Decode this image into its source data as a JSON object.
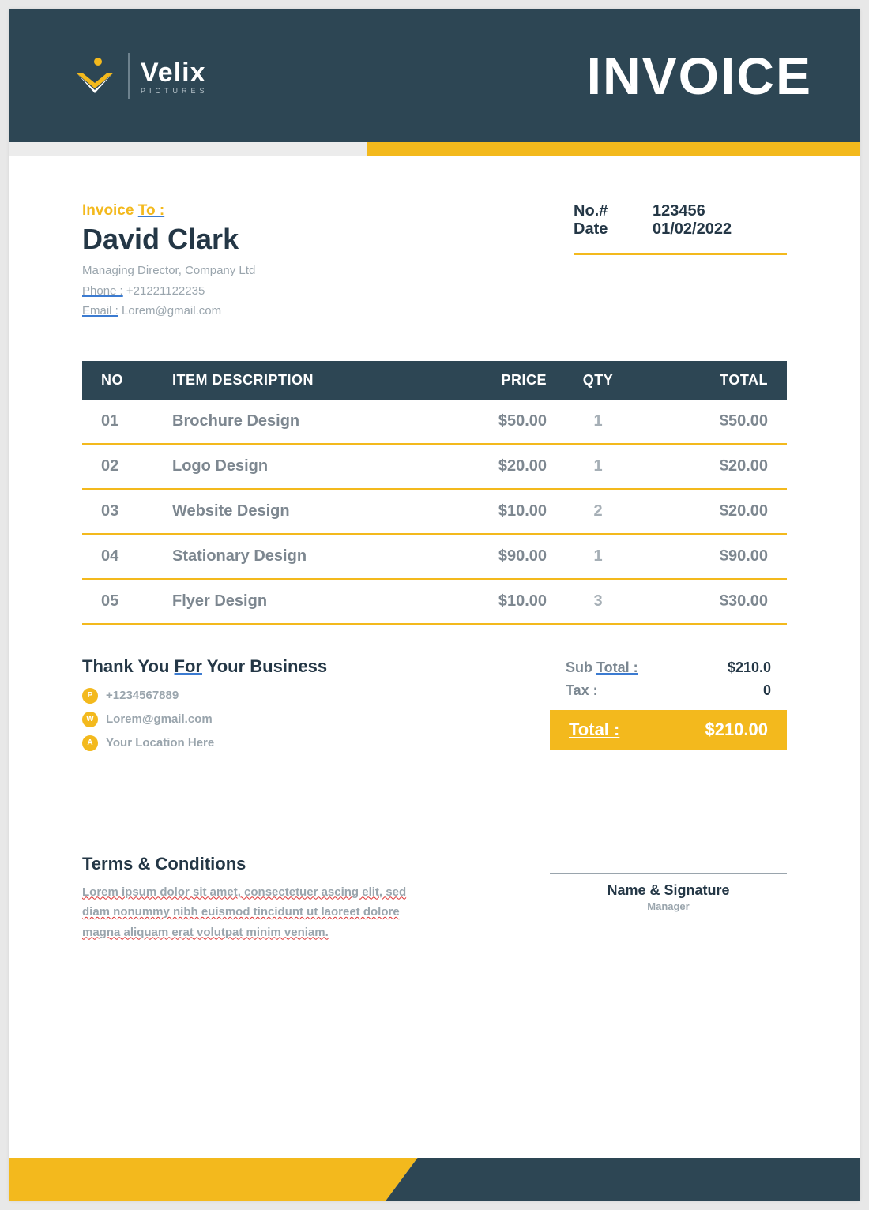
{
  "colors": {
    "dark": "#2d4654",
    "accent": "#f3b91d",
    "muted": "#9aa5ad"
  },
  "brand": {
    "name": "Velix",
    "sub": "PICTURES"
  },
  "title": "INVOICE",
  "invoice_to": {
    "label_a": "Invoice ",
    "label_b": "To :",
    "name": "David Clark",
    "role": "Managing Director, Company Ltd",
    "phone_label": "Phone :",
    "phone": " +21221122235",
    "email_label": "Email :",
    "email": " Lorem@gmail.com"
  },
  "meta": {
    "number_label": "No.#",
    "number": "123456",
    "date_label": "Date",
    "date": "01/02/2022"
  },
  "table": {
    "headers": {
      "no": "NO",
      "desc": "ITEM DESCRIPTION",
      "price": "PRICE",
      "qty": "QTY",
      "total": "TOTAL"
    },
    "rows": [
      {
        "no": "01",
        "desc": "Brochure Design",
        "price": "$50.00",
        "qty": "1",
        "total": "$50.00"
      },
      {
        "no": "02",
        "desc": "Logo Design",
        "price": "$20.00",
        "qty": "1",
        "total": "$20.00"
      },
      {
        "no": "03",
        "desc": "Website Design",
        "price": "$10.00",
        "qty": "2",
        "total": "$20.00"
      },
      {
        "no": "04",
        "desc": "Stationary Design",
        "price": "$90.00",
        "qty": "1",
        "total": "$90.00"
      },
      {
        "no": "05",
        "desc": "Flyer Design",
        "price": "$10.00",
        "qty": "3",
        "total": "$30.00"
      }
    ]
  },
  "thank_you": {
    "pre": "Thank You ",
    "mid": "For",
    "post": " Your Business"
  },
  "contacts": [
    {
      "icon": "P",
      "text": "+1234567889"
    },
    {
      "icon": "W",
      "text": "Lorem@gmail.com"
    },
    {
      "icon": "A",
      "text": "Your Location Here"
    }
  ],
  "totals": {
    "sub_label_a": "Sub ",
    "sub_label_b": "Total :",
    "sub_value": "$210.0",
    "tax_label": "Tax :",
    "tax_value": "0",
    "grand_label": "Total :",
    "grand_value": "$210.00"
  },
  "terms": {
    "heading": "Terms & Conditions",
    "body": "Lorem ipsum dolor sit amet, consectetuer ascing elit, sed diam nonummy nibh euismod tincidunt ut laoreet dolore magna aliquam erat volutpat minim veniam."
  },
  "signature": {
    "name": "Name & Signature",
    "role": "Manager"
  }
}
